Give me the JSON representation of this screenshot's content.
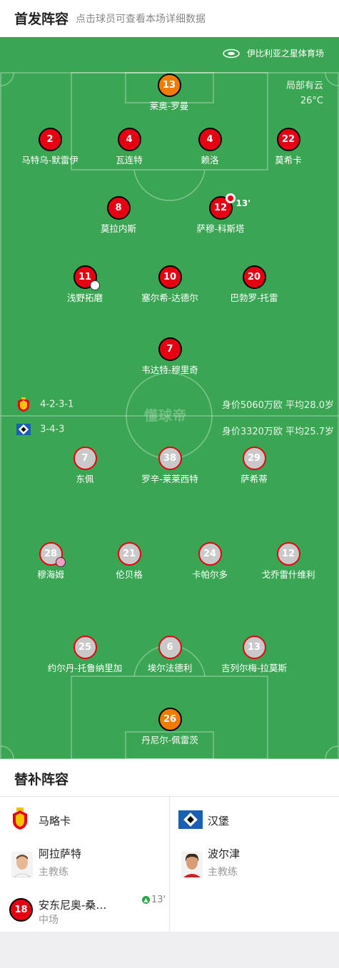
{
  "header": {
    "title": "首发阵容",
    "subtitle": "点击球员可查看本场详细数据"
  },
  "venue": {
    "name": "伊比利亚之星体育场"
  },
  "weather": {
    "condition": "局部有云",
    "temperature": "26°C"
  },
  "watermark": "懂球帝",
  "home": {
    "formation": "4-2-3-1",
    "value": "身价5060万欧 平均28.0岁",
    "players": [
      {
        "number": "13",
        "name": "莱奥-罗曼"
      },
      {
        "number": "2",
        "name": "马特乌-默雷伊"
      },
      {
        "number": "4",
        "name": "瓦连特"
      },
      {
        "number": "4",
        "name": "赖洛"
      },
      {
        "number": "22",
        "name": "莫希卡"
      },
      {
        "number": "8",
        "name": "莫拉内斯"
      },
      {
        "number": "12",
        "name": "萨穆-科斯塔",
        "event": "13'"
      },
      {
        "number": "11",
        "name": "浅野拓磨"
      },
      {
        "number": "10",
        "name": "塞尔希-达德尔"
      },
      {
        "number": "20",
        "name": "巴勃罗-托雷"
      },
      {
        "number": "7",
        "name": "韦达特-穆里奇"
      }
    ]
  },
  "away": {
    "formation": "3-4-3",
    "value": "身价3320万欧 平均25.7岁",
    "players": [
      {
        "number": "7",
        "name": "东佩"
      },
      {
        "number": "38",
        "name": "罗辛-莱莱西特"
      },
      {
        "number": "29",
        "name": "萨希蒂"
      },
      {
        "number": "28",
        "name": "穆海姆"
      },
      {
        "number": "21",
        "name": "伦贝格"
      },
      {
        "number": "24",
        "name": "卡帕尔多"
      },
      {
        "number": "12",
        "name": "戈乔雷什维利"
      },
      {
        "number": "25",
        "name": "约尔丹-托鲁纳里加"
      },
      {
        "number": "6",
        "name": "埃尔法德利"
      },
      {
        "number": "13",
        "name": "吉列尔梅-拉莫斯"
      },
      {
        "number": "26",
        "name": "丹尼尔-佩雷茨"
      }
    ]
  },
  "subs": {
    "title": "替补阵容",
    "home_team": "马略卡",
    "away_team": "汉堡",
    "home_coach": {
      "name": "阿拉萨特",
      "role": "主教练"
    },
    "away_coach": {
      "name": "波尔津",
      "role": "主教练"
    },
    "home_sub": {
      "number": "18",
      "name": "安东尼奥-桑切斯",
      "role": "中场",
      "minute": "13'"
    }
  },
  "colors": {
    "pitch": "#3aa653",
    "home": "#e60012",
    "goalkeeper": "#f07b00",
    "away": "#c9c9c9"
  }
}
